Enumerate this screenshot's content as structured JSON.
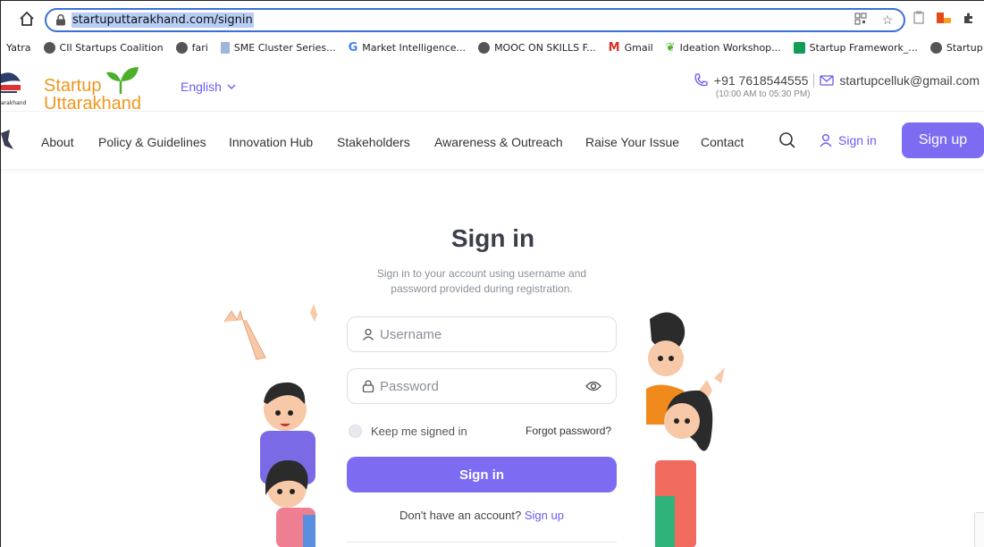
{
  "browser": {
    "url": "startuputtarakhand.com/signin",
    "bookmarks": [
      {
        "label": "Yatra",
        "icon": "bookmark-folder-icon"
      },
      {
        "label": "CII Startups Coalition",
        "icon": "globe-icon"
      },
      {
        "label": "fari",
        "icon": "globe-icon"
      },
      {
        "label": "SME Cluster Series...",
        "icon": "document-icon"
      },
      {
        "label": "Market Intelligence...",
        "icon": "google-icon"
      },
      {
        "label": "MOOC ON SKILLS F...",
        "icon": "globe-icon"
      },
      {
        "label": "Gmail",
        "icon": "gmail-icon"
      },
      {
        "label": "Ideation Workshop...",
        "icon": "sprout-icon"
      },
      {
        "label": "Startup Framework_...",
        "icon": "sheets-icon"
      },
      {
        "label": "Startup Portal",
        "icon": "globe-icon"
      }
    ]
  },
  "header": {
    "logo_line1": "Startup",
    "logo_line2": "Uttarakhand",
    "emblem_text": "arakhand",
    "language": "English",
    "phone": "+91 7618544555",
    "hours": "(10:00 AM to 05:30 PM)",
    "email": "startupcelluk@gmail.com"
  },
  "nav": {
    "items": [
      "About",
      "Policy & Guidelines",
      "Innovation Hub",
      "Stakeholders",
      "Awareness & Outreach",
      "Raise Your Issue",
      "Contact"
    ],
    "signin": "Sign in",
    "signup": "Sign up"
  },
  "form": {
    "title": "Sign in",
    "subtitle": "Sign in to your account using username and password provided during registration.",
    "username_placeholder": "Username",
    "password_placeholder": "Password",
    "remember_label": "Keep me signed in",
    "forgot_label": "Forgot password?",
    "submit_label": "Sign in",
    "no_account_text": "Don't have an account?",
    "signup_link": "Sign up"
  },
  "colors": {
    "accent": "#7c6cf2",
    "brand_orange": "#f0961c",
    "brand_green": "#4caf2a"
  }
}
